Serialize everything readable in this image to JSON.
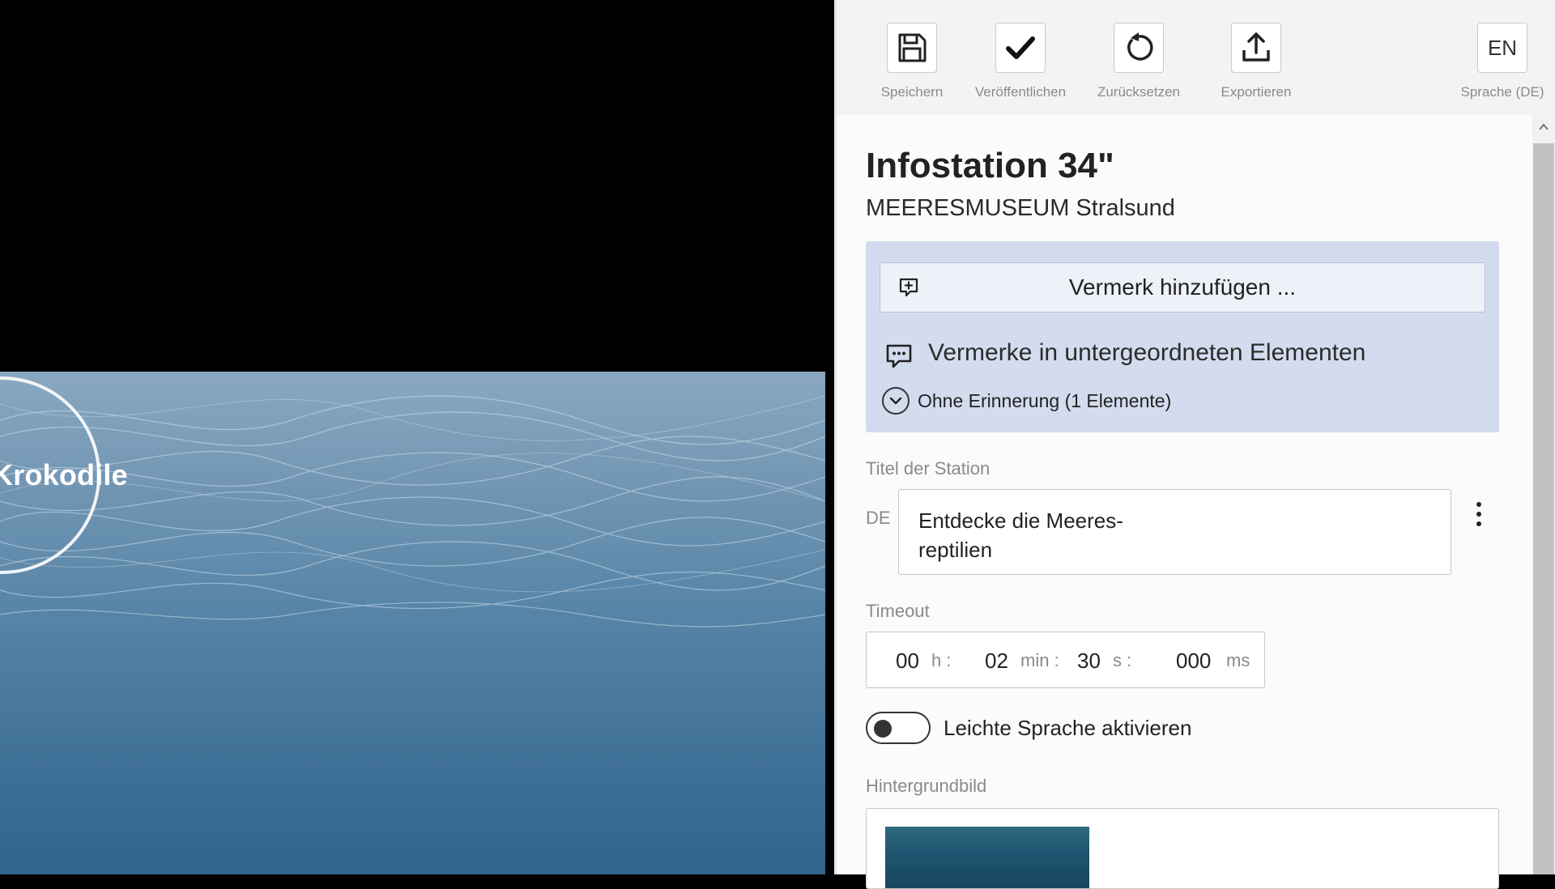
{
  "preview": {
    "bubble_label": "Krokodile"
  },
  "toolbar": {
    "save_label": "Speichern",
    "publish_label": "Veröffentlichen",
    "reset_label": "Zurücksetzen",
    "export_label": "Exportieren",
    "language_button": "EN",
    "language_label": "Sprache (DE)"
  },
  "station": {
    "title": "Infostation 34\"",
    "subtitle": "MEERESMUSEUM Stralsund"
  },
  "notes": {
    "add_note_label": "Vermerk hinzufügen ...",
    "sub_notes_label": "Vermerke in untergeordneten Elementen",
    "no_reminder_label": "Ohne Erinnerung (1 Elemente)"
  },
  "fields": {
    "station_title_label": "Titel der Station",
    "station_title_lang": "DE",
    "station_title_value_line1": "Entdecke die Meeres-",
    "station_title_value_line2": "reptilien",
    "timeout_label": "Timeout",
    "timeout": {
      "hours": "00",
      "hours_unit": "h :",
      "minutes": "02",
      "minutes_unit": "min :",
      "seconds": "30",
      "seconds_unit": "s :",
      "ms": "000",
      "ms_unit": "ms"
    },
    "easy_language_label": "Leichte Sprache aktivieren",
    "easy_language_enabled": false,
    "background_label": "Hintergrundbild"
  },
  "colors": {
    "notes_background": "#d3dcee",
    "panel_background": "#f3f3f3",
    "preview_water": "#4f7fa3"
  }
}
